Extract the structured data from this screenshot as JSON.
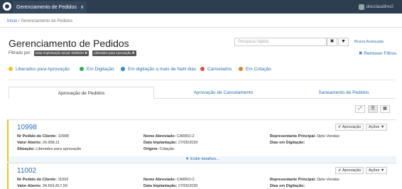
{
  "topbar": {
    "tab_title": "Gerenciamento de Pedidos",
    "tab_close": "x",
    "user": "docclaudino2"
  },
  "breadcrumb": {
    "home": "Início",
    "separator": "/",
    "current": "Gerenciamento de Pedidos"
  },
  "page": {
    "title": "Gerenciamento de Pedidos",
    "filter_label": "Filtrado por:",
    "chips": [
      "Data Implantação Inicial: 03/05/20 ✖",
      "Liberados para Aprovação ✖"
    ]
  },
  "search": {
    "placeholder": "Pesquisa rápida",
    "clear_icon": "✖",
    "filter_icon": "▼",
    "advanced": "Busca Avançada"
  },
  "remove_filters": "✖  Remover Filtros",
  "legend": [
    {
      "label": "Liberados para Aprovação",
      "color": "#f1c40f"
    },
    {
      "label": "Em Digitação",
      "color": "#27ae60"
    },
    {
      "label": "Em digitação a mais de NaN dias",
      "color": "#2e86de"
    },
    {
      "label": "Cancelados",
      "color": "#e74c3c"
    },
    {
      "label": "Em Cotação",
      "color": "#e67e22"
    }
  ],
  "tabs": [
    "Aprovação de Pedidos",
    "Aprovação de Cancelamento",
    "Saneamento de Pedidos"
  ],
  "view_icons": {
    "expand": "⤢",
    "list": "☰",
    "grid": "▦"
  },
  "labels": {
    "client_order": "Nr Pedido do Cliente:",
    "value": "Valor Aberto:",
    "situation": "Situação:",
    "short_name": "Nome Abreviado:",
    "implant_date": "Data Implantação:",
    "origin": "Origem:",
    "representative": "Representante Principal:",
    "days": "Dias em Digitação:",
    "approve": "✔ Aprovação",
    "actions": "Ações ▼",
    "details": "▼ Exibir detalhes..."
  },
  "orders": [
    {
      "number": "10998",
      "client_order": "10998",
      "value": "29.958,11",
      "situation": "Liberados para aprovação",
      "short_name": "CARRO-2",
      "implant_date": "27/05/2020",
      "origin": "Cotação.",
      "representative": "Dpto Vendas",
      "days": ""
    },
    {
      "number": "11002",
      "client_order": "11002",
      "value": "34.663.817,50",
      "short_name": "CARRO-2",
      "implant_date": "27/05/2020",
      "representative": "Dpto Vendas",
      "days": ""
    }
  ]
}
